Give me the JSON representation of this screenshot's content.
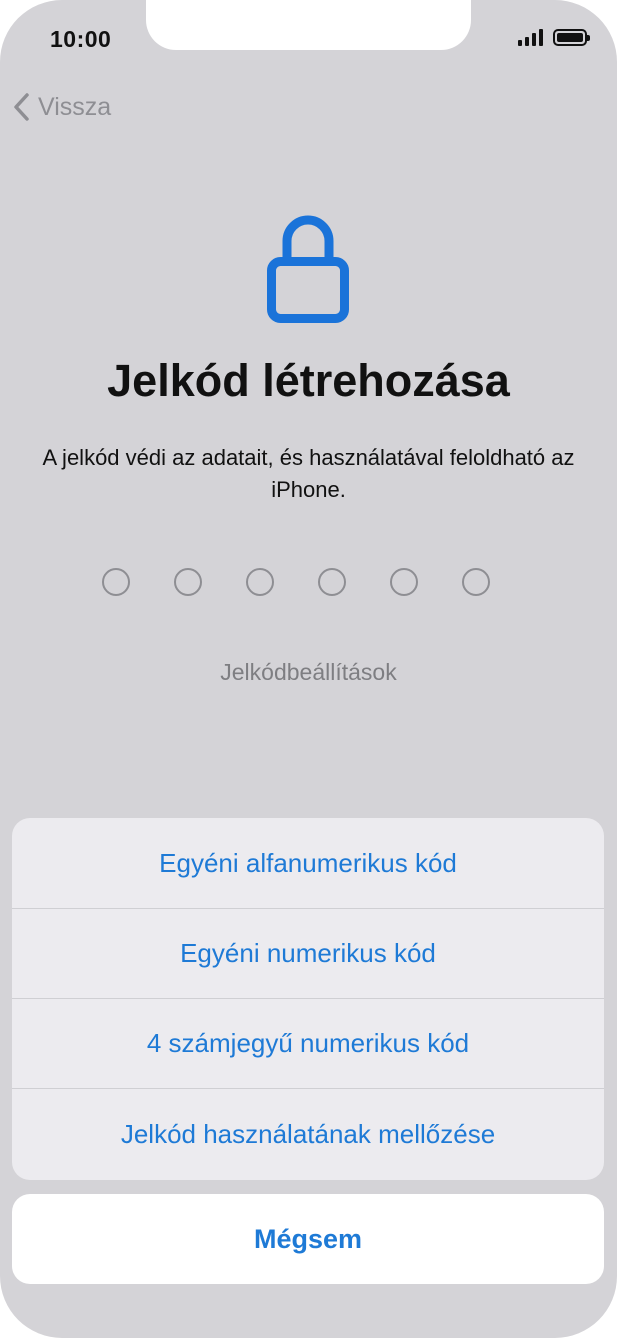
{
  "status_bar": {
    "time": "10:00"
  },
  "nav": {
    "back_label": "Vissza"
  },
  "main": {
    "title": "Jelkód létrehozása",
    "description": "A jelkód védi az adatait, és használatával feloldható az iPhone.",
    "passcode_length": 6,
    "options_link": "Jelkódbeállítások"
  },
  "sheet": {
    "items": [
      {
        "label": "Egyéni alfanumerikus kód"
      },
      {
        "label": "Egyéni numerikus kód"
      },
      {
        "label": "4 számjegyű numerikus kód"
      },
      {
        "label": "Jelkód használatának mellőzése"
      }
    ],
    "cancel_label": "Mégsem"
  },
  "colors": {
    "accent": "#1e7ad6",
    "lock_icon": "#1a73d9"
  },
  "icons": {
    "back": "chevron-left-icon",
    "lock": "lock-icon",
    "signal": "signal-icon",
    "battery": "battery-icon"
  }
}
